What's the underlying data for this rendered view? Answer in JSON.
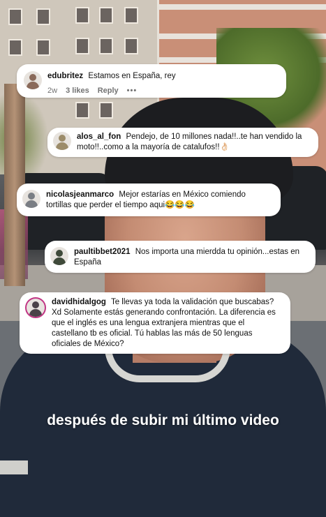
{
  "comments": [
    {
      "username": "edubritez",
      "text": "Estamos en España, rey",
      "age": "2w",
      "likes": "3 likes",
      "reply": "Reply",
      "more": "•••",
      "avatar_color": "#8a6a5a"
    },
    {
      "username": "alos_al_fon",
      "text": "Pendejo, de 10 millones nada!!..te han vendido la moto!!..como a la mayoría de catalufos!!👌🏻",
      "avatar_color": "#9c8c6a"
    },
    {
      "username": "nicolasjeanmarco",
      "text": "Mejor estarías en México comiendo tortillas que perder el tiempo aqui😂😂😂",
      "avatar_color": "#7a7e84"
    },
    {
      "username": "paultibbet2021",
      "text": "Nos importa una mierdda tu opinión...estas en España",
      "avatar_color": "#3f4a3a"
    },
    {
      "username": "davidhidalgog",
      "text": "Te llevas ya toda la validación que buscabas? Xd Solamente estás generando confrontación. La diferencia es que el inglés es una lengua extranjera mientras que el castellano tb es oficial. Tú hablas las más de 50 lenguas oficiales de México?",
      "avatar_color": "#4a4248",
      "story_ring_color": "#c13584"
    }
  ],
  "caption": "después de subir mi último video"
}
